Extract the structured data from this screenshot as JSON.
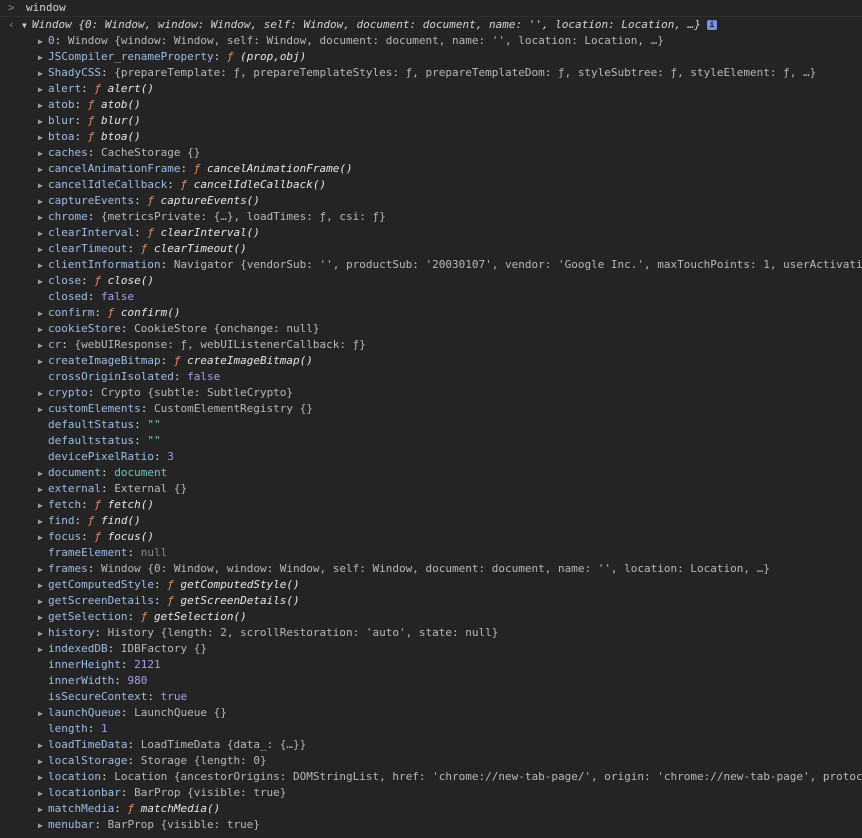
{
  "input": {
    "prompt": ">",
    "command": "window"
  },
  "result": {
    "arrow": "‹",
    "summary": "Window {0: Window, window: Window, self: Window, document: document, name: '', location: Location, …}",
    "info": "i"
  },
  "props": [
    {
      "k": "0",
      "t": "obj",
      "v": "Window {window: Window, self: Window, document: document, name: '', location: Location, …}"
    },
    {
      "k": "JSCompiler_renameProperty",
      "t": "fn",
      "v": "(prop,obj)"
    },
    {
      "k": "ShadyCSS",
      "t": "obj",
      "v": "{prepareTemplate: ƒ, prepareTemplateStyles: ƒ, prepareTemplateDom: ƒ, styleSubtree: ƒ, styleElement: ƒ, …}"
    },
    {
      "k": "alert",
      "t": "fn",
      "v": "alert()"
    },
    {
      "k": "atob",
      "t": "fn",
      "v": "atob()"
    },
    {
      "k": "blur",
      "t": "fn",
      "v": "blur()"
    },
    {
      "k": "btoa",
      "t": "fn",
      "v": "btoa()"
    },
    {
      "k": "caches",
      "t": "obj",
      "v": "CacheStorage {}"
    },
    {
      "k": "cancelAnimationFrame",
      "t": "fn",
      "v": "cancelAnimationFrame()"
    },
    {
      "k": "cancelIdleCallback",
      "t": "fn",
      "v": "cancelIdleCallback()"
    },
    {
      "k": "captureEvents",
      "t": "fn",
      "v": "captureEvents()"
    },
    {
      "k": "chrome",
      "t": "obj",
      "v": "{metricsPrivate: {…}, loadTimes: ƒ, csi: ƒ}"
    },
    {
      "k": "clearInterval",
      "t": "fn",
      "v": "clearInterval()"
    },
    {
      "k": "clearTimeout",
      "t": "fn",
      "v": "clearTimeout()"
    },
    {
      "k": "clientInformation",
      "t": "obj",
      "v": "Navigator {vendorSub: '', productSub: '20030107', vendor: 'Google Inc.', maxTouchPoints: 1, userActivati"
    },
    {
      "k": "close",
      "t": "fn",
      "v": "close()"
    },
    {
      "k": "closed",
      "t": "bool",
      "v": "false"
    },
    {
      "k": "confirm",
      "t": "fn",
      "v": "confirm()"
    },
    {
      "k": "cookieStore",
      "t": "obj",
      "v": "CookieStore {onchange: null}"
    },
    {
      "k": "cr",
      "t": "obj",
      "v": "{webUIResponse: ƒ, webUIListenerCallback: ƒ}"
    },
    {
      "k": "createImageBitmap",
      "t": "fn",
      "v": "createImageBitmap()"
    },
    {
      "k": "crossOriginIsolated",
      "t": "bool",
      "v": "false"
    },
    {
      "k": "crypto",
      "t": "obj",
      "v": "Crypto {subtle: SubtleCrypto}"
    },
    {
      "k": "customElements",
      "t": "obj",
      "v": "CustomElementRegistry {}"
    },
    {
      "k": "defaultStatus",
      "t": "str",
      "v": "\"\""
    },
    {
      "k": "defaultstatus",
      "t": "str",
      "v": "\"\""
    },
    {
      "k": "devicePixelRatio",
      "t": "num",
      "v": "3"
    },
    {
      "k": "document",
      "t": "objc",
      "v": "document"
    },
    {
      "k": "external",
      "t": "obj",
      "v": "External {}"
    },
    {
      "k": "fetch",
      "t": "fn",
      "v": "fetch()"
    },
    {
      "k": "find",
      "t": "fn",
      "v": "find()"
    },
    {
      "k": "focus",
      "t": "fn",
      "v": "focus()"
    },
    {
      "k": "frameElement",
      "t": "null",
      "v": "null"
    },
    {
      "k": "frames",
      "t": "obj",
      "v": "Window {0: Window, window: Window, self: Window, document: document, name: '', location: Location, …}"
    },
    {
      "k": "getComputedStyle",
      "t": "fn",
      "v": "getComputedStyle()"
    },
    {
      "k": "getScreenDetails",
      "t": "fn",
      "v": "getScreenDetails()"
    },
    {
      "k": "getSelection",
      "t": "fn",
      "v": "getSelection()"
    },
    {
      "k": "history",
      "t": "obj",
      "v": "History {length: 2, scrollRestoration: 'auto', state: null}"
    },
    {
      "k": "indexedDB",
      "t": "obj",
      "v": "IDBFactory {}"
    },
    {
      "k": "innerHeight",
      "t": "num",
      "v": "2121"
    },
    {
      "k": "innerWidth",
      "t": "num",
      "v": "980"
    },
    {
      "k": "isSecureContext",
      "t": "bool",
      "v": "true"
    },
    {
      "k": "launchQueue",
      "t": "obj",
      "v": "LaunchQueue {}"
    },
    {
      "k": "length",
      "t": "num",
      "v": "1"
    },
    {
      "k": "loadTimeData",
      "t": "obj",
      "v": "LoadTimeData {data_: {…}}"
    },
    {
      "k": "localStorage",
      "t": "obj",
      "v": "Storage {length: 0}"
    },
    {
      "k": "location",
      "t": "obj",
      "v": "Location {ancestorOrigins: DOMStringList, href: 'chrome://new-tab-page/', origin: 'chrome://new-tab-page', protoc"
    },
    {
      "k": "locationbar",
      "t": "obj",
      "v": "BarProp {visible: true}"
    },
    {
      "k": "matchMedia",
      "t": "fn",
      "v": "matchMedia()"
    },
    {
      "k": "menubar",
      "t": "obj",
      "v": "BarProp {visible: true}"
    }
  ],
  "colors": {
    "background": "#242424",
    "key": "#9cbbe8",
    "function_f": "#f28b54",
    "number": "#a79cf2",
    "string": "#6cc7c0",
    "null": "#8a8a8a"
  },
  "icons": {
    "expand": "triangle-right-icon",
    "collapse": "triangle-down-icon",
    "info": "info-icon"
  }
}
